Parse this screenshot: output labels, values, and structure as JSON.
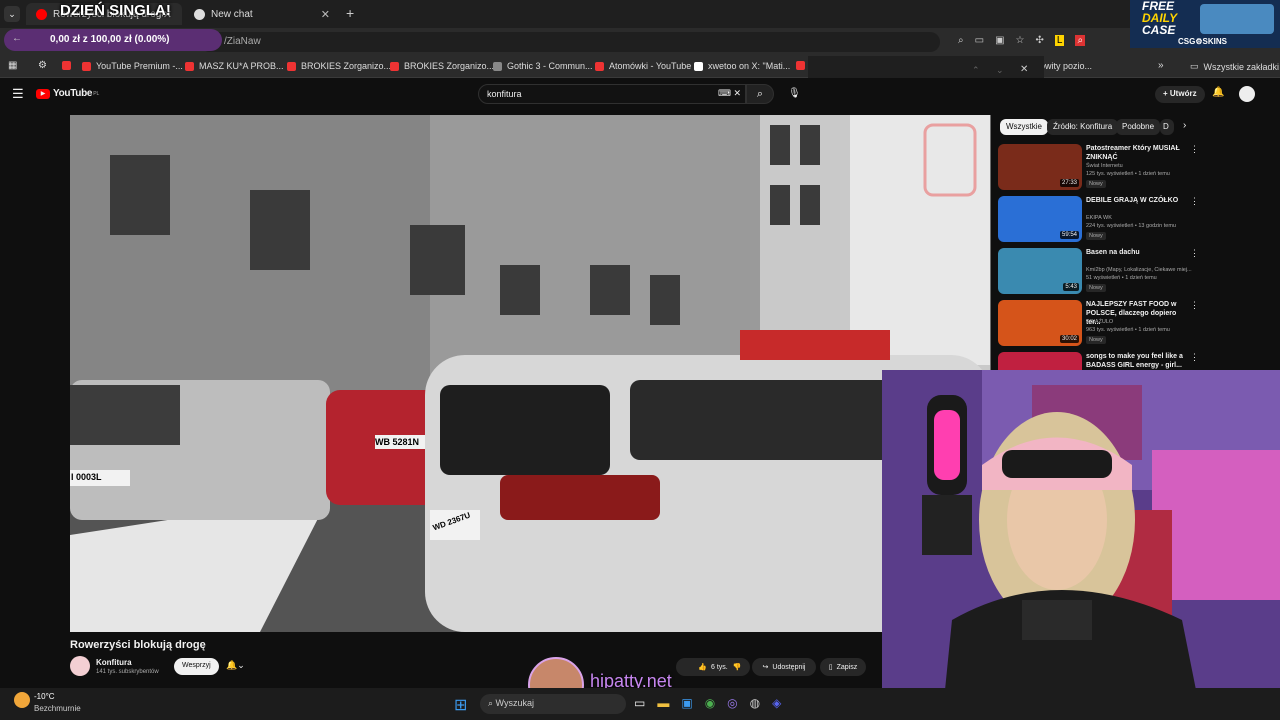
{
  "tabs": [
    {
      "label": "Rowerzyści blokują drogę",
      "active": true
    },
    {
      "label": "New chat",
      "active": false
    }
  ],
  "overlay": {
    "banner": "DZIEŃ SINGLA!",
    "progress": "0,00 zł z 100,00 zł (0.00%)",
    "progress_pct": 0,
    "promo_line1": "FREE",
    "promo_line2": "DAILY",
    "promo_line3": "CASE",
    "promo_brand": "CSG⚙SKINS",
    "site": "hipatty.net"
  },
  "omnibox": {
    "url": "/ZiaNaw"
  },
  "bookmarks": [
    {
      "label": "YouTube Premium -..."
    },
    {
      "label": "MASZ KU*A PROB..."
    },
    {
      "label": "BROKIES Zorganizo..."
    },
    {
      "label": "BROKIES Zorganizo..."
    },
    {
      "label": "Gothic 3 - Commun..."
    },
    {
      "label": "Atomówki - YouTube"
    },
    {
      "label": "xwetoo on X: \"Mati..."
    },
    {
      "label": "owity pozio..."
    },
    {
      "label": "Wszystkie zakładki"
    }
  ],
  "youtube": {
    "logo": "YouTube",
    "region": "PL",
    "search_value": "konfitura",
    "create_label": "Utwórz",
    "video_title": "Rowerzyści blokują drogę",
    "channel": "Konfitura",
    "subs": "141 tys. subskrybentów",
    "support_label": "Wesprzyj",
    "likes": "6 tys.",
    "share": "Udostępnij",
    "save": "Zapisz",
    "plate1": "WB 5281N",
    "plate2": "WD 2367U",
    "plate3": "I 0003L",
    "chips": [
      "Wszystkie",
      "Źródło: Konfitura",
      "Podobne",
      "D"
    ],
    "recs": [
      {
        "title": "Patostreamer Który MUSIAŁ ZNIKNĄĆ",
        "channel": "Świat Internetu",
        "meta": "125 tys. wyświetleń • 1 dzień temu",
        "duration": "27:33",
        "badge": "Nowy",
        "color": "#7a2b1a"
      },
      {
        "title": "DEBILE GRAJĄ W CZÓŁKO",
        "channel": "EKIPA WK",
        "meta": "224 tys. wyświetleń • 13 godzin temu",
        "duration": "59:54",
        "badge": "Nowy",
        "color": "#2a6fd6"
      },
      {
        "title": "Basen na dachu",
        "channel": "Kmi2bp (Mapy, Lokalizacje, Ciekawe miej...",
        "meta": "51 wyświetleń • 1 dzień temu",
        "duration": "5:43",
        "badge": "Nowy",
        "color": "#3a8ab0"
      },
      {
        "title": "NAJLEPSZY FAST FOOD w POLSCE, dlaczego dopiero ter...",
        "channel": "KSIĄŻULO",
        "meta": "963 tys. wyświetleń • 1 dzień temu",
        "duration": "30:02",
        "badge": "Nowy",
        "color": "#d5541a"
      },
      {
        "title": "songs to make you feel like a BADASS GIRL energy - girl...",
        "channel": "",
        "meta": "",
        "duration": "",
        "badge": "",
        "color": "#c02040"
      }
    ]
  },
  "taskbar": {
    "temp": "-10°C",
    "weather": "Bezchmurnie",
    "search": "Wyszukaj"
  }
}
